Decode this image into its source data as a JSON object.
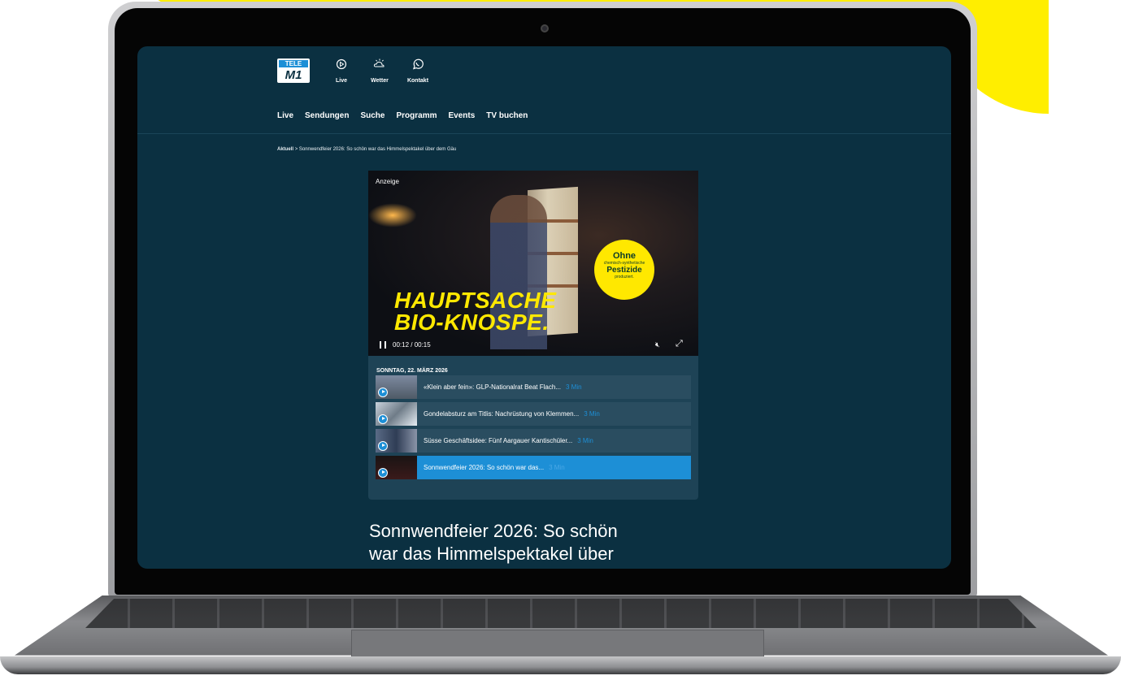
{
  "header": {
    "logo_top": "TELE",
    "logo_bottom": "M1",
    "icons": [
      {
        "label": "Live",
        "icon": "play-circle-icon"
      },
      {
        "label": "Wetter",
        "icon": "weather-icon"
      },
      {
        "label": "Kontakt",
        "icon": "whatsapp-icon"
      }
    ]
  },
  "nav": {
    "items": [
      "Live",
      "Sendungen",
      "Suche",
      "Programm",
      "Events",
      "TV buchen"
    ]
  },
  "breadcrumb": {
    "root": "Aktuell",
    "separator": ">",
    "current": "Sonnwendfeier 2026: So schön war das Himmelspektakel über dem Gäu"
  },
  "video": {
    "ad_label": "Anzeige",
    "headline_line1": "HAUPTSACHE",
    "headline_line2": "BIO-KNOSPE.",
    "badge_line1": "Ohne",
    "badge_line2": "chemisch-synthetische",
    "badge_line3": "Pestizide",
    "badge_line4": "produziert.",
    "timecode": "00:12 / 00:15",
    "mute_icon": "mute-icon",
    "fullscreen_icon": "fullscreen-icon"
  },
  "playlist": {
    "date": "SONNTAG, 22. MÄRZ 2026",
    "items": [
      {
        "title": "«Klein aber fein»: GLP-Nationalrat Beat Flach...",
        "duration": "3 Min"
      },
      {
        "title": "Gondelabsturz am Titlis: Nachrüstung von Klemmen...",
        "duration": "3 Min"
      },
      {
        "title": "Süsse Geschäftsidee: Fünf Aargauer Kantischüler...",
        "duration": "3 Min"
      },
      {
        "title": "Sonnwendfeier 2026: So schön war das...",
        "duration": "3 Min"
      }
    ]
  },
  "article": {
    "title_line1": "Sonnwendfeier 2026: So schön",
    "title_line2": "war das Himmelspektakel über"
  },
  "colors": {
    "page_bg": "#0b3041",
    "accent": "#1d8fd6",
    "ad_yellow": "#ffe800",
    "backdrop_yellow": "#ffee00"
  }
}
